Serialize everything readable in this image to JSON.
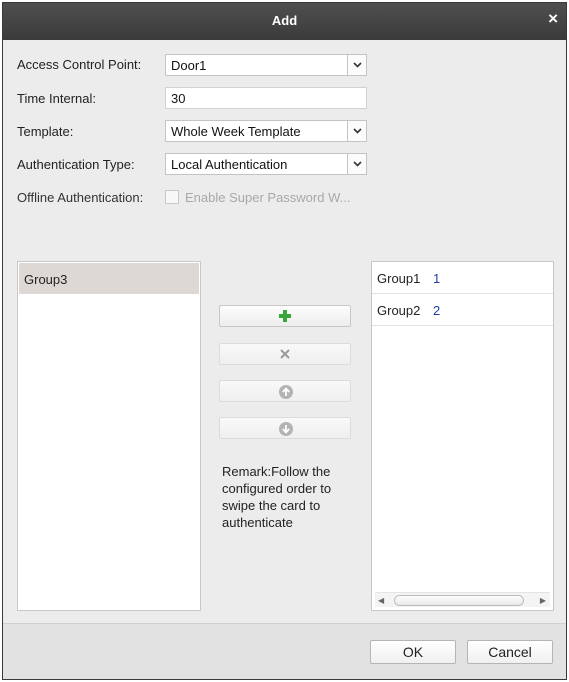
{
  "dialog": {
    "title": "Add",
    "close_symbol": "×"
  },
  "form": {
    "access_control_point": {
      "label": "Access Control Point:",
      "value": "Door1"
    },
    "time_interval": {
      "label": "Time Internal:",
      "value": "30"
    },
    "template": {
      "label": "Template:",
      "value": "Whole Week Template"
    },
    "authentication_type": {
      "label": "Authentication Type:",
      "value": "Local Authentication"
    },
    "offline_authentication": {
      "label": "Offline Authentication:",
      "checkbox_label": "Enable Super Password W...",
      "checked": false,
      "enabled": false
    }
  },
  "available_groups": [
    {
      "name": "Group3",
      "selected": true
    }
  ],
  "selected_groups": [
    {
      "name": "Group1",
      "order": "1"
    },
    {
      "name": "Group2",
      "order": "2"
    }
  ],
  "actions": {
    "add_icon": "plus-icon",
    "remove_icon": "x-icon",
    "up_icon": "arrow-up-circle-icon",
    "down_icon": "arrow-down-circle-icon",
    "add_color": "#3aa63a"
  },
  "remark": "Remark:Follow the configured order to swipe the card to authenticate",
  "buttons": {
    "ok": "OK",
    "cancel": "Cancel"
  }
}
